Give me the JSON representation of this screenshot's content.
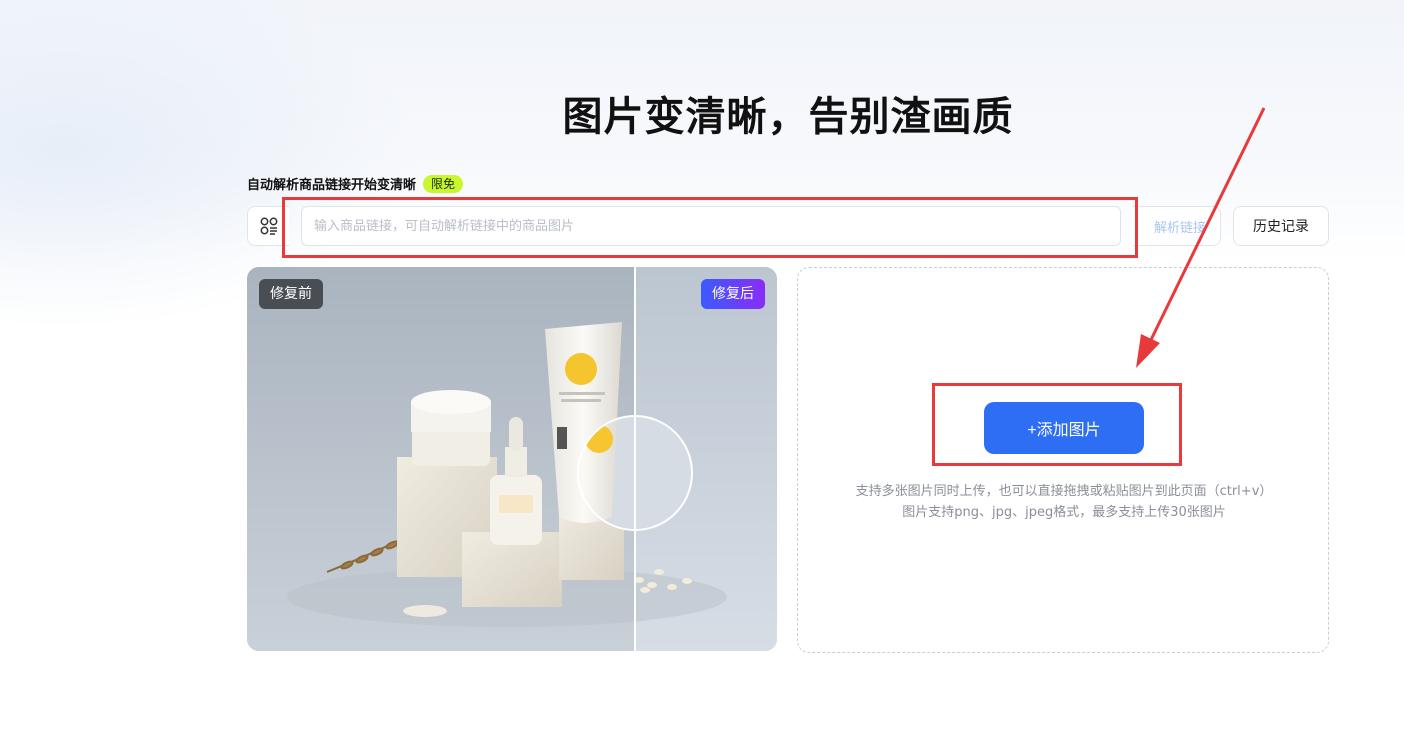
{
  "page": {
    "title": "图片变清晰，告别渣画质"
  },
  "link_section": {
    "subtitle": "自动解析商品链接开始变清晰",
    "badge": "限免",
    "input_placeholder": "输入商品链接，可自动解析链接中的商品图片",
    "parse_label": "解析链接",
    "history_label": "历史记录"
  },
  "compare": {
    "before_label": "修复前",
    "after_label": "修复后"
  },
  "upload": {
    "add_label": "+添加图片",
    "hint_line1": "支持多张图片同时上传，也可以直接拖拽或粘贴图片到此页面（ctrl+v）",
    "hint_line2": "图片支持png、jpg、jpeg格式，最多支持上传30张图片"
  },
  "colors": {
    "accent": "#2e6ef5",
    "highlight": "#e8393b",
    "badge_green": "#c8f72e"
  }
}
